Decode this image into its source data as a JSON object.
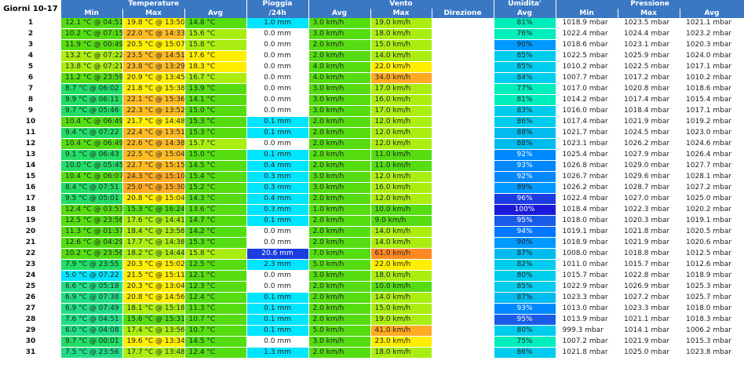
{
  "header": {
    "corner": "Giorni 10-17",
    "groups": {
      "temperature": "Temperature",
      "pioggia": "Pioggia",
      "vento": "Vento",
      "umidita": "Umidita'",
      "pressione": "Pressione"
    },
    "sub": {
      "t_min": "Min",
      "t_max": "Max",
      "t_avg": "Avg",
      "rain": "/24h",
      "w_avg": "Avg",
      "w_max": "Max",
      "w_dir": "Direzione",
      "hum_avg": "Avg",
      "p_min": "Min",
      "p_max": "Max",
      "p_avg": "Avg"
    }
  },
  "colors": {
    "header": "#3a78c4",
    "deep_blue": "#1a3ce0",
    "cyan": "#00e5ff",
    "green": "#55dd11",
    "yellow": "#ffee00",
    "orange": "#ffaa22"
  },
  "rows": [
    {
      "day": "1",
      "tmin": "12.1 °C @ 04:51",
      "tmax": "19.8 °C @ 13:50",
      "tavg": "14.8 °C",
      "rain": "1.0 mm",
      "wavg": "3.0 km/h",
      "wmax": "19.0 km/h",
      "dir": "",
      "hum": "81%",
      "pmin": "1018.9 mbar",
      "pmax": "1023.5 mbar",
      "pavg": "1021.1 mbar",
      "ctmin": "#55dd11",
      "ctmax": "#ffee00",
      "ctavg": "#55dd11",
      "crain": "#00e5ff",
      "cwavg": "#55dd11",
      "cwmax": "#aaee11",
      "chum": "#00eebb"
    },
    {
      "day": "2",
      "tmin": "10.2 °C @ 07:15",
      "tmax": "22.0 °C @ 14:33",
      "tavg": "15.6 °C",
      "rain": "0.0 mm",
      "wavg": "3.0 km/h",
      "wmax": "18.0 km/h",
      "dir": "",
      "hum": "76%",
      "pmin": "1022.4 mbar",
      "pmax": "1024.4 mbar",
      "pavg": "1023.2 mbar",
      "ctmin": "#55dd11",
      "ctmax": "#ffbb22",
      "ctavg": "#aaee11",
      "crain": "#ffffff",
      "cwavg": "#55dd11",
      "cwmax": "#aaee11",
      "chum": "#00eebb"
    },
    {
      "day": "3",
      "tmin": "11.9 °C @ 00:49",
      "tmax": "20.5 °C @ 15:07",
      "tavg": "15.8 °C",
      "rain": "0.0 mm",
      "wavg": "2.0 km/h",
      "wmax": "15.0 km/h",
      "dir": "",
      "hum": "90%",
      "pmin": "1018.6 mbar",
      "pmax": "1023.1 mbar",
      "pavg": "1020.3 mbar",
      "ctmin": "#55dd11",
      "ctmax": "#ffee00",
      "ctavg": "#aaee11",
      "crain": "#ffffff",
      "cwavg": "#55dd11",
      "cwmax": "#aaee11",
      "chum": "#0099ff"
    },
    {
      "day": "4",
      "tmin": "13.2 °C @ 07:22",
      "tmax": "23.5 °C @ 14:51",
      "tavg": "17.6 °C",
      "rain": "0.0 mm",
      "wavg": "2.0 km/h",
      "wmax": "14.0 km/h",
      "dir": "",
      "hum": "85%",
      "pmin": "1022.5 mbar",
      "pmax": "1025.9 mbar",
      "pavg": "1024.0 mbar",
      "ctmin": "#aaee11",
      "ctmax": "#ffbb22",
      "ctavg": "#ffee00",
      "crain": "#ffffff",
      "cwavg": "#55dd11",
      "cwmax": "#aaee11",
      "chum": "#00ccee"
    },
    {
      "day": "5",
      "tmin": "13.8 °C @ 07:21",
      "tmax": "23.8 °C @ 13:29",
      "tavg": "18.3 °C",
      "rain": "0.0 mm",
      "wavg": "4.0 km/h",
      "wmax": "22.0 km/h",
      "dir": "",
      "hum": "85%",
      "pmin": "1010.2 mbar",
      "pmax": "1022.5 mbar",
      "pavg": "1017.1 mbar",
      "ctmin": "#aaee11",
      "ctmax": "#ffbb22",
      "ctavg": "#ffee00",
      "crain": "#ffffff",
      "cwavg": "#55dd11",
      "cwmax": "#ffee00",
      "chum": "#00ccee"
    },
    {
      "day": "6",
      "tmin": "11.2 °C @ 23:59",
      "tmax": "20.9 °C @ 13:45",
      "tavg": "16.7 °C",
      "rain": "0.0 mm",
      "wavg": "4.0 km/h",
      "wmax": "34.0 km/h",
      "dir": "",
      "hum": "84%",
      "pmin": "1007.7 mbar",
      "pmax": "1017.2 mbar",
      "pavg": "1010.2 mbar",
      "ctmin": "#55dd11",
      "ctmax": "#ffee00",
      "ctavg": "#aaee11",
      "crain": "#ffffff",
      "cwavg": "#55dd11",
      "cwmax": "#ffaa22",
      "chum": "#00ccee"
    },
    {
      "day": "7",
      "tmin": "8.7 °C @ 06:02",
      "tmax": "21.8 °C @ 15:38",
      "tavg": "13.9 °C",
      "rain": "0.0 mm",
      "wavg": "3.0 km/h",
      "wmax": "17.0 km/h",
      "dir": "",
      "hum": "77%",
      "pmin": "1017.0 mbar",
      "pmax": "1020.8 mbar",
      "pavg": "1018.6 mbar",
      "ctmin": "#22dd66",
      "ctmax": "#ffee00",
      "ctavg": "#55dd11",
      "crain": "#ffffff",
      "cwavg": "#55dd11",
      "cwmax": "#aaee11",
      "chum": "#00eebb"
    },
    {
      "day": "8",
      "tmin": "9.9 °C @ 06:11",
      "tmax": "22.1 °C @ 15:36",
      "tavg": "14.1 °C",
      "rain": "0.0 mm",
      "wavg": "3.0 km/h",
      "wmax": "16.0 km/h",
      "dir": "",
      "hum": "81%",
      "pmin": "1014.2 mbar",
      "pmax": "1017.4 mbar",
      "pavg": "1015.4 mbar",
      "ctmin": "#22dd66",
      "ctmax": "#ffbb22",
      "ctavg": "#55dd11",
      "crain": "#ffffff",
      "cwavg": "#55dd11",
      "cwmax": "#aaee11",
      "chum": "#00eebb"
    },
    {
      "day": "9",
      "tmin": "9.7 °C @ 05:46",
      "tmax": "22.3 °C @ 13:52",
      "tavg": "15.0 °C",
      "rain": "0.0 mm",
      "wavg": "3.0 km/h",
      "wmax": "17.0 km/h",
      "dir": "",
      "hum": "83%",
      "pmin": "1016.0 mbar",
      "pmax": "1018.4 mbar",
      "pavg": "1017.1 mbar",
      "ctmin": "#22dd66",
      "ctmax": "#ffbb22",
      "ctavg": "#55dd11",
      "crain": "#ffffff",
      "cwavg": "#55dd11",
      "cwmax": "#aaee11",
      "chum": "#00ccee"
    },
    {
      "day": "10",
      "tmin": "10.4 °C @ 06:49",
      "tmax": "21.7 °C @ 14:48",
      "tavg": "15.3 °C",
      "rain": "0.1 mm",
      "wavg": "2.0 km/h",
      "wmax": "12.0 km/h",
      "dir": "",
      "hum": "86%",
      "pmin": "1017.4 mbar",
      "pmax": "1021.9 mbar",
      "pavg": "1019.2 mbar",
      "ctmin": "#55dd11",
      "ctmax": "#ffee00",
      "ctavg": "#55dd11",
      "crain": "#00e5ff",
      "cwavg": "#55dd11",
      "cwmax": "#aaee11",
      "chum": "#00ccee"
    },
    {
      "day": "11",
      "tmin": "9.4 °C @ 07:22",
      "tmax": "22.4 °C @ 13:51",
      "tavg": "15.3 °C",
      "rain": "0.1 mm",
      "wavg": "2.0 km/h",
      "wmax": "12.0 km/h",
      "dir": "",
      "hum": "88%",
      "pmin": "1021.7 mbar",
      "pmax": "1024.5 mbar",
      "pavg": "1023.0 mbar",
      "ctmin": "#22dd66",
      "ctmax": "#ffbb22",
      "ctavg": "#55dd11",
      "crain": "#00e5ff",
      "cwavg": "#55dd11",
      "cwmax": "#aaee11",
      "chum": "#00bbee"
    },
    {
      "day": "12",
      "tmin": "10.4 °C @ 06:49",
      "tmax": "22.6 °C @ 14:38",
      "tavg": "15.7 °C",
      "rain": "0.0 mm",
      "wavg": "2.0 km/h",
      "wmax": "12.0 km/h",
      "dir": "",
      "hum": "88%",
      "pmin": "1023.1 mbar",
      "pmax": "1026.2 mbar",
      "pavg": "1024.6 mbar",
      "ctmin": "#55dd11",
      "ctmax": "#ffbb22",
      "ctavg": "#aaee11",
      "crain": "#ffffff",
      "cwavg": "#55dd11",
      "cwmax": "#aaee11",
      "chum": "#00bbee"
    },
    {
      "day": "13",
      "tmin": "9.1 °C @ 06:43",
      "tmax": "22.5 °C @ 15:04",
      "tavg": "15.0 °C",
      "rain": "0.1 mm",
      "wavg": "2.0 km/h",
      "wmax": "11.0 km/h",
      "dir": "",
      "hum": "92%",
      "pmin": "1025.4 mbar",
      "pmax": "1027.9 mbar",
      "pavg": "1026.4 mbar",
      "ctmin": "#22dd66",
      "ctmax": "#ffbb22",
      "ctavg": "#55dd11",
      "crain": "#00e5ff",
      "cwavg": "#55dd11",
      "cwmax": "#55dd11",
      "chum": "#0088ff"
    },
    {
      "day": "14",
      "tmin": "10.0 °C @ 05:45",
      "tmax": "22.7 °C @ 15:15",
      "tavg": "14.5 °C",
      "rain": "0.4 mm",
      "wavg": "2.0 km/h",
      "wmax": "11.0 km/h",
      "dir": "",
      "hum": "93%",
      "pmin": "1026.8 mbar",
      "pmax": "1029.0 mbar",
      "pavg": "1027.7 mbar",
      "ctmin": "#22dd66",
      "ctmax": "#ffbb22",
      "ctavg": "#55dd11",
      "crain": "#00e5ff",
      "cwavg": "#55dd11",
      "cwmax": "#55dd11",
      "chum": "#0088ff"
    },
    {
      "day": "15",
      "tmin": "10.4 °C @ 06:07",
      "tmax": "24.3 °C @ 15:10",
      "tavg": "15.4 °C",
      "rain": "0.3 mm",
      "wavg": "3.0 km/h",
      "wmax": "12.0 km/h",
      "dir": "",
      "hum": "92%",
      "pmin": "1026.7 mbar",
      "pmax": "1029.6 mbar",
      "pavg": "1028.1 mbar",
      "ctmin": "#55dd11",
      "ctmax": "#ffaa22",
      "ctavg": "#55dd11",
      "crain": "#00e5ff",
      "cwavg": "#55dd11",
      "cwmax": "#aaee11",
      "chum": "#0088ff"
    },
    {
      "day": "16",
      "tmin": "8.4 °C @ 07:51",
      "tmax": "25.0 °C @ 15:30",
      "tavg": "15.2 °C",
      "rain": "0.3 mm",
      "wavg": "3.0 km/h",
      "wmax": "16.0 km/h",
      "dir": "",
      "hum": "89%",
      "pmin": "1026.2 mbar",
      "pmax": "1028.7 mbar",
      "pavg": "1027.2 mbar",
      "ctmin": "#22dd66",
      "ctmax": "#ffaa22",
      "ctavg": "#55dd11",
      "crain": "#00e5ff",
      "cwavg": "#55dd11",
      "cwmax": "#aaee11",
      "chum": "#0099ff"
    },
    {
      "day": "17",
      "tmin": "9.5 °C @ 05:01",
      "tmax": "20.8 °C @ 15:04",
      "tavg": "14.3 °C",
      "rain": "0.4 mm",
      "wavg": "2.0 km/h",
      "wmax": "12.0 km/h",
      "dir": "",
      "hum": "96%",
      "pmin": "1022.4 mbar",
      "pmax": "1027.0 mbar",
      "pavg": "1025.0 mbar",
      "ctmin": "#22dd66",
      "ctmax": "#ffee00",
      "ctavg": "#55dd11",
      "crain": "#00e5ff",
      "cwavg": "#55dd11",
      "cwmax": "#aaee11",
      "chum": "#1a3ce0"
    },
    {
      "day": "18",
      "tmin": "12.4 °C @ 03:53",
      "tmax": "15.3 °C @ 16:24",
      "tavg": "13.6 °C",
      "rain": "0.3 mm",
      "wavg": "1.0 km/h",
      "wmax": "10.0 km/h",
      "dir": "",
      "hum": "100%",
      "pmin": "1018.4 mbar",
      "pmax": "1022.3 mbar",
      "pavg": "1020.2 mbar",
      "ctmin": "#55dd11",
      "ctmax": "#55dd11",
      "ctavg": "#55dd11",
      "crain": "#00e5ff",
      "cwavg": "#55dd11",
      "cwmax": "#55dd11",
      "chum": "#1a1ad8"
    },
    {
      "day": "19",
      "tmin": "12.5 °C @ 23:56",
      "tmax": "17.6 °C @ 14:41",
      "tavg": "14.7 °C",
      "rain": "0.1 mm",
      "wavg": "2.0 km/h",
      "wmax": "9.0 km/h",
      "dir": "",
      "hum": "95%",
      "pmin": "1018.0 mbar",
      "pmax": "1020.3 mbar",
      "pavg": "1019.1 mbar",
      "ctmin": "#55dd11",
      "ctmax": "#aaee11",
      "ctavg": "#55dd11",
      "crain": "#00e5ff",
      "cwavg": "#55dd11",
      "cwmax": "#55dd11",
      "chum": "#1a5ce8"
    },
    {
      "day": "20",
      "tmin": "11.3 °C @ 01:37",
      "tmax": "18.4 °C @ 13:58",
      "tavg": "14.2 °C",
      "rain": "0.0 mm",
      "wavg": "2.0 km/h",
      "wmax": "14.0 km/h",
      "dir": "",
      "hum": "94%",
      "pmin": "1019.1 mbar",
      "pmax": "1021.8 mbar",
      "pavg": "1020.5 mbar",
      "ctmin": "#55dd11",
      "ctmax": "#aaee11",
      "ctavg": "#55dd11",
      "crain": "#ffffff",
      "cwavg": "#55dd11",
      "cwmax": "#aaee11",
      "chum": "#0077ff"
    },
    {
      "day": "21",
      "tmin": "12.6 °C @ 04:29",
      "tmax": "17.7 °C @ 14:38",
      "tavg": "15.3 °C",
      "rain": "0.0 mm",
      "wavg": "2.0 km/h",
      "wmax": "14.0 km/h",
      "dir": "",
      "hum": "90%",
      "pmin": "1018.9 mbar",
      "pmax": "1021.9 mbar",
      "pavg": "1020.6 mbar",
      "ctmin": "#55dd11",
      "ctmax": "#aaee11",
      "ctavg": "#55dd11",
      "crain": "#ffffff",
      "cwavg": "#55dd11",
      "cwmax": "#aaee11",
      "chum": "#0099ff"
    },
    {
      "day": "22",
      "tmin": "10.2 °C @ 23:56",
      "tmax": "18.2 °C @ 14:44",
      "tavg": "15.8 °C",
      "rain": "20.6 mm",
      "wavg": "7.0 km/h",
      "wmax": "61.0 km/h",
      "dir": "",
      "hum": "87%",
      "pmin": "1008.0 mbar",
      "pmax": "1018.8 mbar",
      "pavg": "1012.5 mbar",
      "ctmin": "#55dd11",
      "ctmax": "#aaee11",
      "ctavg": "#aaee11",
      "crain": "#1a3ce0",
      "cwavg": "#55dd11",
      "cwmax": "#ff8822",
      "chum": "#00bbee"
    },
    {
      "day": "23",
      "tmin": "7.9 °C @ 23:55",
      "tmax": "20.3 °C @ 15:02",
      "tavg": "12.5 °C",
      "rain": "2.3 mm",
      "wavg": "5.0 km/h",
      "wmax": "22.0 km/h",
      "dir": "",
      "hum": "82%",
      "pmin": "1011.0 mbar",
      "pmax": "1015.7 mbar",
      "pavg": "1012.6 mbar",
      "ctmin": "#22dd66",
      "ctmax": "#ffee00",
      "ctavg": "#55dd11",
      "crain": "#00e5ff",
      "cwavg": "#55dd11",
      "cwmax": "#ffee00",
      "chum": "#00ccee"
    },
    {
      "day": "24",
      "tmin": "5.0 °C @ 07:22",
      "tmax": "21.5 °C @ 15:11",
      "tavg": "12.1 °C",
      "rain": "0.0 mm",
      "wavg": "3.0 km/h",
      "wmax": "18.0 km/h",
      "dir": "",
      "hum": "80%",
      "pmin": "1015.7 mbar",
      "pmax": "1022.8 mbar",
      "pavg": "1018.9 mbar",
      "ctmin": "#00e5ff",
      "ctmax": "#ffee00",
      "ctavg": "#55dd11",
      "crain": "#ffffff",
      "cwavg": "#55dd11",
      "cwmax": "#aaee11",
      "chum": "#00ccee"
    },
    {
      "day": "25",
      "tmin": "6.6 °C @ 05:18",
      "tmax": "20.3 °C @ 13:04",
      "tavg": "12.3 °C",
      "rain": "0.0 mm",
      "wavg": "2.0 km/h",
      "wmax": "10.0 km/h",
      "dir": "",
      "hum": "85%",
      "pmin": "1022.9 mbar",
      "pmax": "1026.9 mbar",
      "pavg": "1025.3 mbar",
      "ctmin": "#22dd88",
      "ctmax": "#ffee00",
      "ctavg": "#55dd11",
      "crain": "#ffffff",
      "cwavg": "#55dd11",
      "cwmax": "#55dd11",
      "chum": "#00ccee"
    },
    {
      "day": "26",
      "tmin": "6.9 °C @ 07:38",
      "tmax": "20.8 °C @ 14:56",
      "tavg": "12.4 °C",
      "rain": "0.1 mm",
      "wavg": "2.0 km/h",
      "wmax": "14.0 km/h",
      "dir": "",
      "hum": "87%",
      "pmin": "1023.3 mbar",
      "pmax": "1027.2 mbar",
      "pavg": "1025.7 mbar",
      "ctmin": "#22dd88",
      "ctmax": "#ffee00",
      "ctavg": "#55dd11",
      "crain": "#00e5ff",
      "cwavg": "#55dd11",
      "cwmax": "#aaee11",
      "chum": "#00bbee"
    },
    {
      "day": "27",
      "tmin": "6.9 °C @ 07:49",
      "tmax": "18.1 °C @ 15:18",
      "tavg": "11.3 °C",
      "rain": "0.1 mm",
      "wavg": "2.0 km/h",
      "wmax": "15.0 km/h",
      "dir": "",
      "hum": "93%",
      "pmin": "1013.0 mbar",
      "pmax": "1023.3 mbar",
      "pavg": "1018.0 mbar",
      "ctmin": "#22dd88",
      "ctmax": "#aaee11",
      "ctavg": "#55dd11",
      "crain": "#00e5ff",
      "cwavg": "#55dd11",
      "cwmax": "#aaee11",
      "chum": "#0088ff"
    },
    {
      "day": "28",
      "tmin": "7.6 °C @ 04:51",
      "tmax": "15.6 °C @ 15:31",
      "tavg": "10.7 °C",
      "rain": "0.1 mm",
      "wavg": "2.0 km/h",
      "wmax": "19.0 km/h",
      "dir": "",
      "hum": "95%",
      "pmin": "1013.9 mbar",
      "pmax": "1021.1 mbar",
      "pavg": "1018.3 mbar",
      "ctmin": "#22dd88",
      "ctmax": "#55dd11",
      "ctavg": "#55dd11",
      "crain": "#00e5ff",
      "cwavg": "#55dd11",
      "cwmax": "#aaee11",
      "chum": "#1a5ce8"
    },
    {
      "day": "29",
      "tmin": "6.0 °C @ 04:08",
      "tmax": "17.4 °C @ 13:56",
      "tavg": "10.7 °C",
      "rain": "0.1 mm",
      "wavg": "5.0 km/h",
      "wmax": "41.0 km/h",
      "dir": "",
      "hum": "80%",
      "pmin": "999.3 mbar",
      "pmax": "1014.1 mbar",
      "pavg": "1006.2 mbar",
      "ctmin": "#22dd88",
      "ctmax": "#aaee11",
      "ctavg": "#55dd11",
      "crain": "#00e5ff",
      "cwavg": "#55dd11",
      "cwmax": "#ffaa22",
      "chum": "#00ccee"
    },
    {
      "day": "30",
      "tmin": "9.7 °C @ 00:01",
      "tmax": "19.6 °C @ 13:34",
      "tavg": "14.5 °C",
      "rain": "0.0 mm",
      "wavg": "3.0 km/h",
      "wmax": "23.0 km/h",
      "dir": "",
      "hum": "75%",
      "pmin": "1007.2 mbar",
      "pmax": "1021.9 mbar",
      "pavg": "1015.3 mbar",
      "ctmin": "#22dd66",
      "ctmax": "#ffee00",
      "ctavg": "#55dd11",
      "crain": "#ffffff",
      "cwavg": "#55dd11",
      "cwmax": "#ffee00",
      "chum": "#00eebb"
    },
    {
      "day": "31",
      "tmin": "7.5 °C @ 23:56",
      "tmax": "17.7 °C @ 13:48",
      "tavg": "12.4 °C",
      "rain": "1.3 mm",
      "wavg": "2.0 km/h",
      "wmax": "18.0 km/h",
      "dir": "",
      "hum": "86%",
      "pmin": "1021.8 mbar",
      "pmax": "1025.0 mbar",
      "pavg": "1023.8 mbar",
      "ctmin": "#22dd88",
      "ctmax": "#aaee11",
      "ctavg": "#55dd11",
      "crain": "#00e5ff",
      "cwavg": "#55dd11",
      "cwmax": "#aaee11",
      "chum": "#00ccee"
    }
  ]
}
